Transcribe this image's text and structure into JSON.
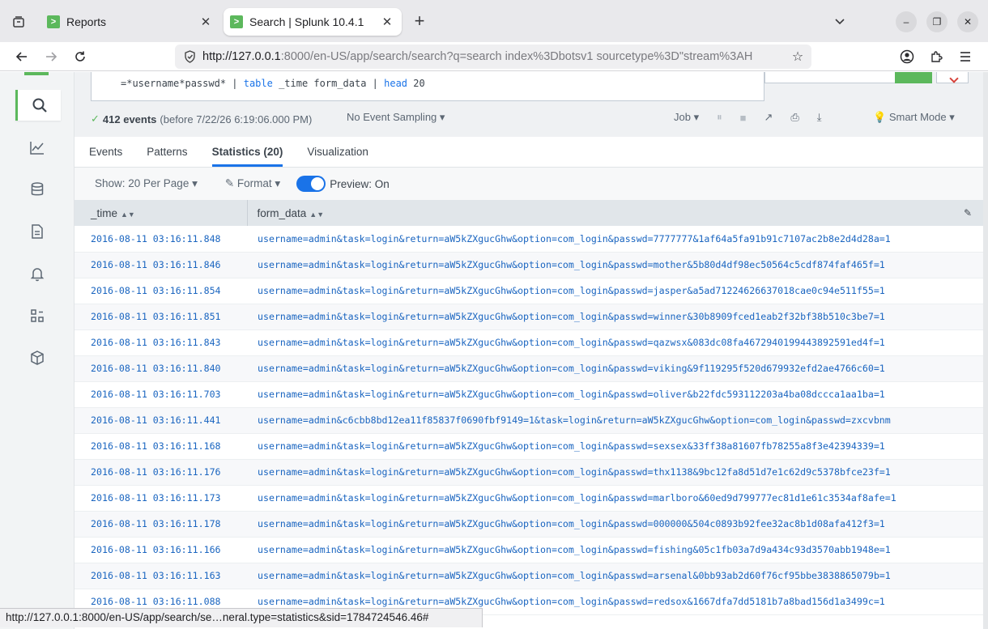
{
  "browser": {
    "tabs": [
      {
        "title": "Reports",
        "active": false
      },
      {
        "title": "Search | Splunk 10.4.1",
        "active": true
      }
    ],
    "url_host": "http://127.0.0.1",
    "url_rest": ":8000/en-US/app/search/search?q=search index%3Dbotsv1 sourcetype%3D\"stream%3AH",
    "status_url": "http://127.0.0.1:8000/en-US/app/search/se…neral.type=statistics&sid=1784724546.46#"
  },
  "icons": {
    "tab_strip": "tab-overview-icon",
    "back": "back-arrow-icon",
    "forward": "forward-arrow-icon",
    "reload": "reload-icon",
    "shield": "shield-icon",
    "star": "star-icon",
    "account": "account-icon",
    "extensions": "extensions-icon",
    "menu": "hamburger-menu-icon"
  },
  "search": {
    "query_line_prefix": "=*username*passwd* | ",
    "kw_table": "table",
    "query_fields": " _time form_data | ",
    "kw_head": "head",
    "query_tail": " 20"
  },
  "status": {
    "check": "✓",
    "events": "412 events",
    "before": "(before 7/22/26 6:19:06.000 PM)",
    "sampling": "No Event Sampling ▾",
    "job": "Job ▾",
    "pause": "⏸",
    "stop": "■",
    "share": "↗",
    "print": "⎙",
    "export": "⤓",
    "smart_mode": "Smart Mode ▾"
  },
  "result_tabs": [
    "Events",
    "Patterns",
    "Statistics (20)",
    "Visualization"
  ],
  "toolbar": {
    "show": "Show: 20 Per Page ▾",
    "format": "✎ Format ▾",
    "preview": "Preview: On"
  },
  "columns": [
    "_time",
    "form_data"
  ],
  "rows": [
    [
      "2016-08-11 03:16:11.848",
      "username=admin&task=login&return=aW5kZXgucGhw&option=com_login&passwd=7777777&1af64a5fa91b91c7107ac2b8e2d4d28a=1"
    ],
    [
      "2016-08-11 03:16:11.846",
      "username=admin&task=login&return=aW5kZXgucGhw&option=com_login&passwd=mother&5b80d4df98ec50564c5cdf874faf465f=1"
    ],
    [
      "2016-08-11 03:16:11.854",
      "username=admin&task=login&return=aW5kZXgucGhw&option=com_login&passwd=jasper&a5ad71224626637018cae0c94e511f55=1"
    ],
    [
      "2016-08-11 03:16:11.851",
      "username=admin&task=login&return=aW5kZXgucGhw&option=com_login&passwd=winner&30b8909fced1eab2f32bf38b510c3be7=1"
    ],
    [
      "2016-08-11 03:16:11.843",
      "username=admin&task=login&return=aW5kZXgucGhw&option=com_login&passwd=qazwsx&083dc08fa4672940199443892591ed4f=1"
    ],
    [
      "2016-08-11 03:16:11.840",
      "username=admin&task=login&return=aW5kZXgucGhw&option=com_login&passwd=viking&9f119295f520d679932efd2ae4766c60=1"
    ],
    [
      "2016-08-11 03:16:11.703",
      "username=admin&task=login&return=aW5kZXgucGhw&option=com_login&passwd=oliver&b22fdc593112203a4ba08dccca1aa1ba=1"
    ],
    [
      "2016-08-11 03:16:11.441",
      "username=admin&c6cbb8bd12ea11f85837f0690fbf9149=1&task=login&return=aW5kZXgucGhw&option=com_login&passwd=zxcvbnm"
    ],
    [
      "2016-08-11 03:16:11.168",
      "username=admin&task=login&return=aW5kZXgucGhw&option=com_login&passwd=sexsex&33ff38a81607fb78255a8f3e42394339=1"
    ],
    [
      "2016-08-11 03:16:11.176",
      "username=admin&task=login&return=aW5kZXgucGhw&option=com_login&passwd=thx1138&9bc12fa8d51d7e1c62d9c5378bfce23f=1"
    ],
    [
      "2016-08-11 03:16:11.173",
      "username=admin&task=login&return=aW5kZXgucGhw&option=com_login&passwd=marlboro&60ed9d799777ec81d1e61c3534af8afe=1"
    ],
    [
      "2016-08-11 03:16:11.178",
      "username=admin&task=login&return=aW5kZXgucGhw&option=com_login&passwd=000000&504c0893b92fee32ac8b1d08afa412f3=1"
    ],
    [
      "2016-08-11 03:16:11.166",
      "username=admin&task=login&return=aW5kZXgucGhw&option=com_login&passwd=fishing&05c1fb03a7d9a434c93d3570abb1948e=1"
    ],
    [
      "2016-08-11 03:16:11.163",
      "username=admin&task=login&return=aW5kZXgucGhw&option=com_login&passwd=arsenal&0bb93ab2d60f76cf95bbe3838865079b=1"
    ],
    [
      "2016-08-11 03:16:11.088",
      "username=admin&task=login&return=aW5kZXgucGhw&option=com_login&passwd=redsox&1667dfa7dd5181b7a8bad156d1a3499c=1"
    ]
  ]
}
